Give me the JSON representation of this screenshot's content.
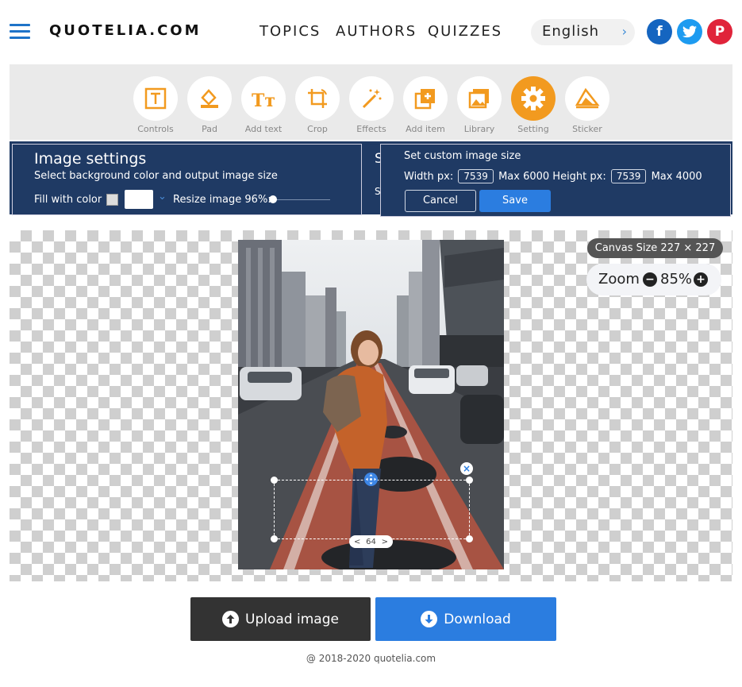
{
  "header": {
    "logo": "QUOTELIA.COM",
    "nav": [
      "TOPICS",
      "AUTHORS",
      "QUIZZES"
    ],
    "language": "English",
    "social": [
      {
        "name": "facebook",
        "glyph": "f",
        "color": "#1565c0"
      },
      {
        "name": "twitter",
        "glyph": "t",
        "color": "#1d9bf0"
      },
      {
        "name": "pinterest",
        "glyph": "P",
        "color": "#e0243a"
      }
    ]
  },
  "toolbar": {
    "tools": [
      {
        "label": "Controls",
        "icon": "controls-icon"
      },
      {
        "label": "Pad",
        "icon": "pad-icon"
      },
      {
        "label": "Add text",
        "icon": "add-text-icon"
      },
      {
        "label": "Crop",
        "icon": "crop-icon"
      },
      {
        "label": "Effects",
        "icon": "effects-icon"
      },
      {
        "label": "Add item",
        "icon": "add-item-icon"
      },
      {
        "label": "Library",
        "icon": "library-icon"
      },
      {
        "label": "Setting",
        "icon": "setting-icon",
        "active": true
      },
      {
        "label": "Sticker",
        "icon": "sticker-icon"
      }
    ],
    "accent": "#f29a1f"
  },
  "image_settings": {
    "title": "Image settings",
    "subtitle": "Select background color and output image size",
    "fill_label": "Fill with color",
    "resize_label": "Resize image 96%:",
    "resize_value": 96,
    "hidden_panel_letters": [
      "S",
      "S"
    ]
  },
  "custom_size": {
    "title": "Set custom image size",
    "width_label": "Width px:",
    "width_value": "7539",
    "width_max": "Max 6000",
    "height_label": "Height px:",
    "height_value": "7539",
    "height_max": "Max 4000",
    "cancel": "Cancel",
    "save": "Save"
  },
  "canvas": {
    "size_label": "Canvas Size 227 × 227 px",
    "zoom_label": "Zoom",
    "zoom_minus": "−",
    "zoom_value": "85%",
    "zoom_plus": "+",
    "selection_value": "64",
    "selection_close": "×",
    "selection_prev": "<",
    "selection_next": ">"
  },
  "actions": {
    "upload": "Upload image",
    "download": "Download"
  },
  "footer": "@ 2018-2020 quotelia.com",
  "colors": {
    "panel_navy": "#1f3a64",
    "primary_blue": "#2b7de0",
    "upload_dark": "#333333"
  }
}
